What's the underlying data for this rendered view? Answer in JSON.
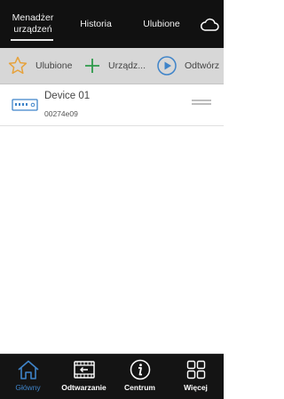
{
  "header": {
    "tabs": [
      {
        "line1": "Menadżer",
        "line2": "urządzeń"
      },
      {
        "label": "Historia"
      },
      {
        "label": "Ulubione"
      }
    ],
    "cloud_icon": "cloud-icon"
  },
  "toolbar": {
    "favorites_label": "Ulubione",
    "add_label": "Urządz...",
    "play_label": "Odtwórz"
  },
  "devices": [
    {
      "name": "Device 01",
      "id": "00274e09"
    }
  ],
  "bottom_nav": [
    {
      "label": "Główny",
      "icon": "home-icon"
    },
    {
      "label": "Odtwarzanie",
      "icon": "playback-icon"
    },
    {
      "label": "Centrum",
      "icon": "info-icon"
    },
    {
      "label": "Więcej",
      "icon": "more-grid-icon"
    }
  ],
  "colors": {
    "topbar": "#111111",
    "toolbar": "#d7d7d7",
    "accent_blue": "#3f84c9",
    "star_orange": "#e6a23c",
    "plus_green": "#2e9a4a"
  }
}
